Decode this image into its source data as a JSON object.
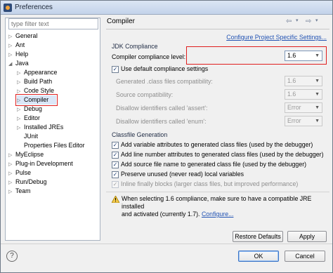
{
  "window": {
    "title": "Preferences"
  },
  "filter": {
    "placeholder": "type filter text"
  },
  "tree": [
    {
      "label": "General",
      "arrow": "▷"
    },
    {
      "label": "Ant",
      "arrow": "▷"
    },
    {
      "label": "Help",
      "arrow": "▷"
    },
    {
      "label": "Java",
      "arrow": "◢"
    },
    {
      "label": "Appearance",
      "arrow": "▷"
    },
    {
      "label": "Build Path",
      "arrow": "▷"
    },
    {
      "label": "Code Style",
      "arrow": "▷"
    },
    {
      "label": "Compiler",
      "arrow": "▷"
    },
    {
      "label": "Debug",
      "arrow": "▷"
    },
    {
      "label": "Editor",
      "arrow": "▷"
    },
    {
      "label": "Installed JREs",
      "arrow": "▷"
    },
    {
      "label": "JUnit",
      "arrow": ""
    },
    {
      "label": "Properties Files Editor",
      "arrow": ""
    },
    {
      "label": "MyEclipse",
      "arrow": "▷"
    },
    {
      "label": "Plug-in Development",
      "arrow": "▷"
    },
    {
      "label": "Pulse",
      "arrow": "▷"
    },
    {
      "label": "Run/Debug",
      "arrow": "▷"
    },
    {
      "label": "Team",
      "arrow": "▷"
    }
  ],
  "page": {
    "title": "Compiler",
    "configure_link": "Configure Project Specific Settings...",
    "jdk_group": "JDK Compliance",
    "compliance_label": "Compiler compliance level:",
    "compliance_value": "1.6",
    "use_default_label": "Use default compliance settings",
    "generated_label": "Generated .class files compatibility:",
    "generated_value": "1.6",
    "source_label": "Source compatibility:",
    "source_value": "1.6",
    "assert_label": "Disallow identifiers called 'assert':",
    "assert_value": "Error",
    "enum_label": "Disallow identifiers called 'enum':",
    "enum_value": "Error",
    "classfile_group": "Classfile Generation",
    "check1": "Add variable attributes to generated class files (used by the debugger)",
    "check2": "Add line number attributes to generated class files (used by the debugger)",
    "check3": "Add source file name to generated class file (used by the debugger)",
    "check4": "Preserve unused (never read) local variables",
    "check5": "Inline finally blocks (larger class files, but improved performance)",
    "warning_line1": "When selecting 1.6 compliance, make sure to have a compatible JRE installed",
    "warning_line2_prefix": "and activated (currently 1.7).",
    "warning_link": "Configure...",
    "restore_button": "Restore Defaults",
    "apply_button": "Apply"
  },
  "footer": {
    "ok": "OK",
    "cancel": "Cancel"
  }
}
